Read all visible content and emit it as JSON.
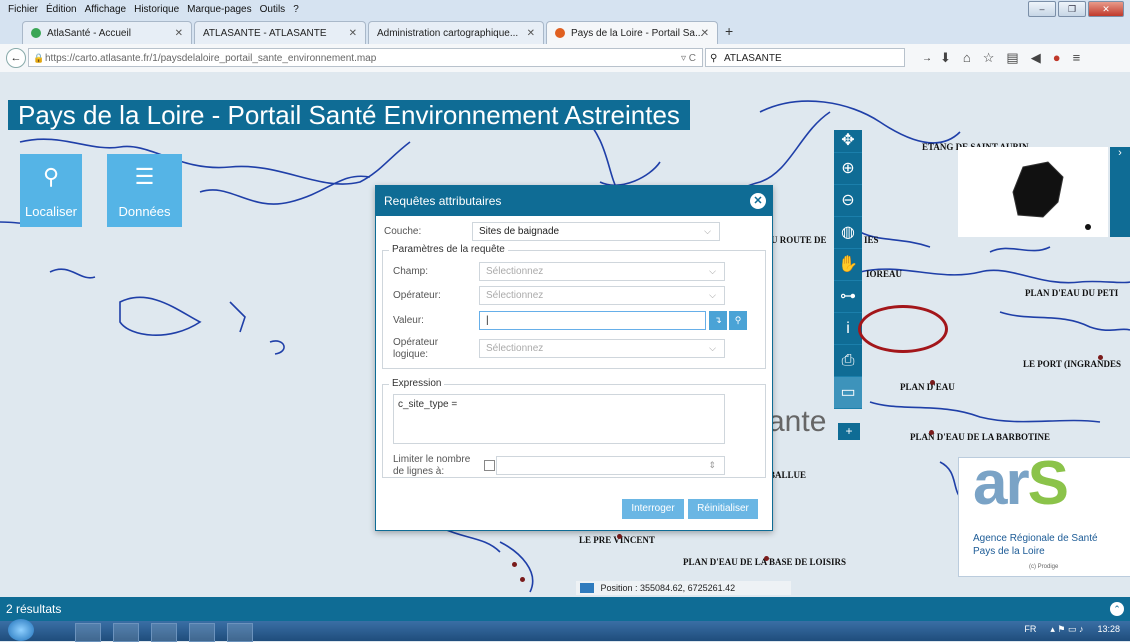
{
  "browser": {
    "menu": [
      "Fichier",
      "Édition",
      "Affichage",
      "Historique",
      "Marque-pages",
      "Outils",
      "?"
    ],
    "tabs": [
      {
        "label": "AtlaSanté - Accueil",
        "icon_color": "#3aa655"
      },
      {
        "label": "ATLASANTE - ATLASANTE",
        "icon_color": "#ffffff"
      },
      {
        "label": "Administration cartographique...",
        "icon_color": "#ffffff"
      },
      {
        "label": "Pays de la Loire - Portail Sa...",
        "icon_color": "#e06020"
      }
    ],
    "url": "https://carto.atlasante.fr/1/paysdelaloire_portail_sante_environnement.map",
    "search_value": "ATLASANTE"
  },
  "map": {
    "title": "Pays de la Loire - Portail Santé Environnement Astreintes",
    "buttons": {
      "localiser": "Localiser",
      "donnees": "Données"
    },
    "labels": [
      {
        "text": "ETANG DE SAINT AUBIN"
      },
      {
        "text": "U ROUTE DE"
      },
      {
        "text": "IES"
      },
      {
        "text": "IOREAU"
      },
      {
        "text": "PLAN D'EAU DU PETI"
      },
      {
        "text": "LE PORT (INGRANDES"
      },
      {
        "text": "PLAN D'EAU"
      },
      {
        "text": "PLAN D'EAU DE LA BARBOTINE"
      },
      {
        "text": "BALLUE"
      },
      {
        "text": "LE PRE VINCENT"
      },
      {
        "text": "PLAN D'EAU DE LA BASE DE LOISIRS"
      }
    ],
    "big_text": "ante",
    "position": "Position : 355084.62, 6725261.42",
    "ars": {
      "line1": "Agence Régionale de Santé",
      "line2": "Pays de la Loire",
      "line3": "(c) Prodige"
    }
  },
  "dialog": {
    "title": "Requêtes attributaires",
    "couche_label": "Couche:",
    "couche_value": "Sites de baignade",
    "params_legend": "Paramètres de la requête",
    "champ_label": "Champ:",
    "champ_placeholder": "Sélectionnez",
    "operateur_label": "Opérateur:",
    "operateur_placeholder": "Sélectionnez",
    "valeur_label": "Valeur:",
    "oplog_label_1": "Opérateur",
    "oplog_label_2": "logique:",
    "oplog_placeholder": "Sélectionnez",
    "expression_legend": "Expression",
    "expression_value": "c_site_type =",
    "limit_label_1": "Limiter le nombre",
    "limit_label_2": "de lignes à:",
    "btn_interroger": "Interroger",
    "btn_reinit": "Réinitialiser"
  },
  "footer": {
    "results": "2 résultats"
  },
  "taskbar": {
    "lang": "FR",
    "time": "13:28"
  }
}
